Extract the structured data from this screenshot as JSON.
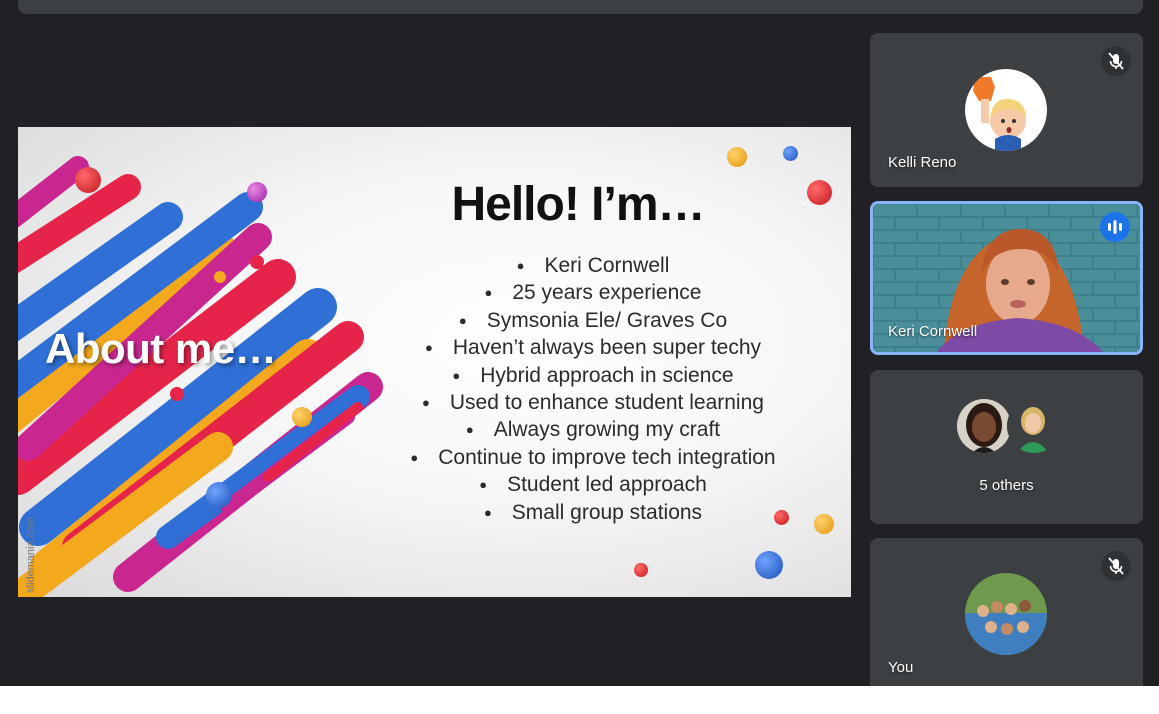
{
  "slide": {
    "side_title": "About me…",
    "title": "Hello! I’m…",
    "bullets": [
      "Keri Cornwell",
      "25 years experience",
      "Symsonia Ele/ Graves Co",
      "Haven’t always been super techy",
      "Hybrid approach in science",
      "Used to enhance student learning",
      "Always growing my craft",
      "Continue to improve tech integration",
      "Student led approach",
      "Small group stations"
    ],
    "watermark": "slidemania.com"
  },
  "participants": {
    "kelli": {
      "name": "Kelli Reno",
      "muted": true
    },
    "keri": {
      "name": "Keri Cornwell",
      "speaking": true
    },
    "others": {
      "label": "5 others"
    },
    "you": {
      "name": "You",
      "muted": true
    }
  },
  "colors": {
    "background": "#202124",
    "tile": "#3c4043",
    "speaking_border": "#8ab4f8",
    "speaking_icon": "#1a73e8"
  }
}
